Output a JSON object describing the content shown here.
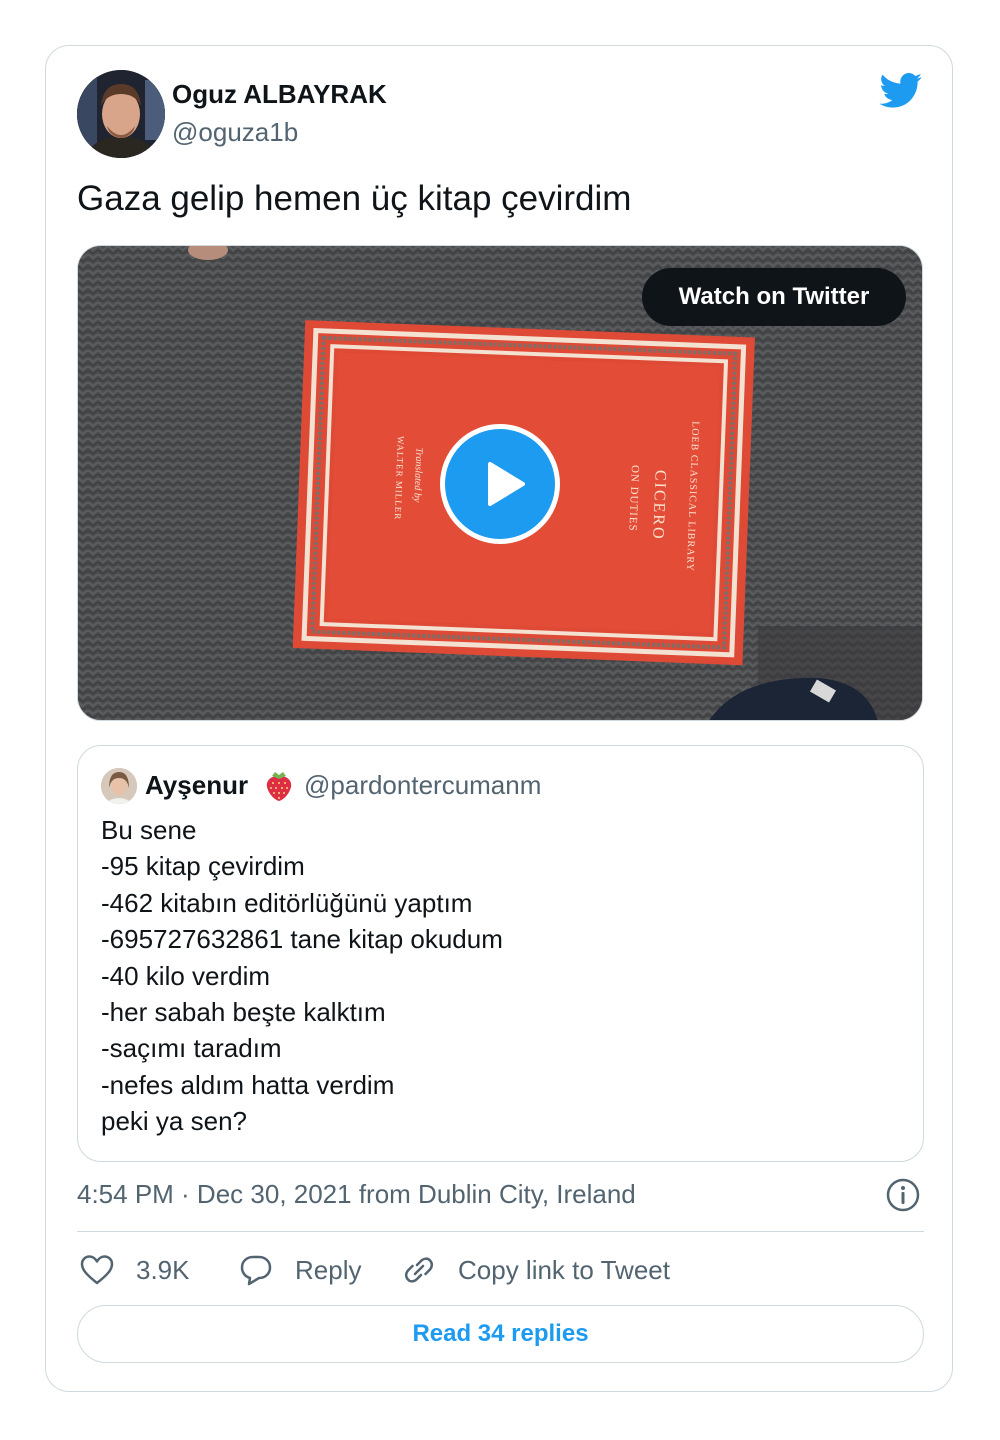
{
  "tweet": {
    "author_name": "Oguz ALBAYRAK",
    "author_handle": "@oguza1b",
    "text": "Gaza gelip hemen üç kitap çevirdim",
    "watch_label": "Watch on Twitter",
    "book": {
      "series": "LOEB CLASSICAL LIBRARY",
      "title": "CICERO",
      "subtitle": "ON DUTIES",
      "translated_by": "Translated by",
      "translator": "WALTER MILLER"
    },
    "meta": "4:54 PM · Dec 30, 2021 from Dublin City, Ireland",
    "icons": {
      "brand": "twitter-bird-icon",
      "play": "play-icon",
      "info": "info-icon",
      "like": "heart-icon",
      "reply": "speech-bubble-icon",
      "copy": "link-icon"
    }
  },
  "quote": {
    "author_name": "Ayşenur",
    "emoji": "strawberry",
    "author_handle": "@pardontercumanm",
    "lines": [
      "Bu sene",
      "-95 kitap çevirdim",
      "-462 kitabın editörlüğünü yaptım",
      "-695727632861 tane kitap okudum",
      "-40 kilo verdim",
      "-her sabah beşte kalktım",
      "-saçımı taradım",
      "-nefes aldım hatta verdim",
      "peki ya sen?"
    ]
  },
  "actions": {
    "likes": "3.9K",
    "reply_label": "Reply",
    "copy_label": "Copy link to Tweet",
    "read_replies_label": "Read 34 replies"
  },
  "colors": {
    "accent": "#1d9bf0",
    "text": "#0f1419",
    "secondary": "#536471",
    "border": "#cfd9de",
    "book_cover": "#e04a36"
  }
}
